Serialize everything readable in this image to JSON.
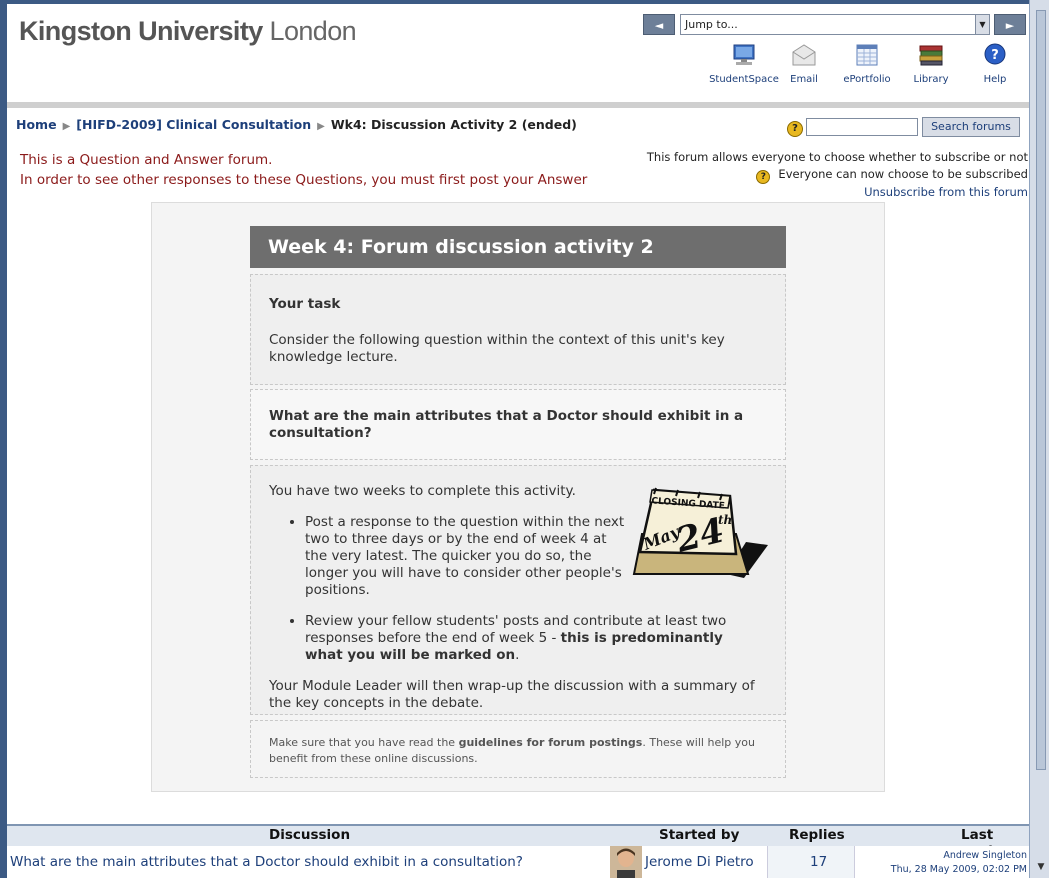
{
  "header": {
    "logo_bold": "Kingston University",
    "logo_light": "London",
    "jump_to": "Jump to...",
    "jump_prev": "◄",
    "jump_next": "►",
    "quick_links": {
      "studentspace": "StudentSpace",
      "email": "Email",
      "eportfolio": "ePortfolio",
      "library": "Library",
      "help": "Help"
    }
  },
  "breadcrumb": {
    "home": "Home",
    "course": "[HIFD-2009] Clinical Consultation",
    "current": "Wk4: Discussion Activity 2 (ended)"
  },
  "search": {
    "button": "Search forums",
    "value": ""
  },
  "notice": {
    "line1": "This is a Question and Answer forum.",
    "line2": "In order to see other responses to these Questions, you must  first post your Answer"
  },
  "subscription": {
    "line1": "This forum allows everyone to choose whether to subscribe or not",
    "line2": "Everyone can now choose to be subscribed",
    "unsubscribe": "Unsubscribe from this forum"
  },
  "intro": {
    "title": "Week 4: Forum discussion activity 2",
    "task_heading": "Your task",
    "task_text": "Consider the following question within the context of this unit's key knowledge lecture.",
    "question": "What are the main attributes that a Doctor should exhibit in a consultation?",
    "lead": "You have two weeks to complete this activity.",
    "bullet1": "Post a response to the question within the next two to three days or by the end of week 4 at the very latest. The quicker you do so, the longer you will have to consider other people's positions.",
    "bullet2_plain": "Review your fellow students' posts and contribute at least two responses before the end of week 5 - ",
    "bullet2_bold": "this is predominantly what you will be marked on",
    "bullet2_end": ".",
    "closing": "Your Module Leader will then wrap-up the discussion with a summary of the key concepts in the debate.",
    "guidelines_pre": "Make sure that you have read the ",
    "guidelines_bold": "guidelines for forum postings",
    "guidelines_post": ". These will help you benefit from these online discussions.",
    "calendar_heading": "CLOSING DATE",
    "calendar_month": "May",
    "calendar_day": "24",
    "calendar_suffix": "th"
  },
  "table": {
    "headers": {
      "discussion": "Discussion",
      "started_by": "Started by",
      "replies": "Replies",
      "last_post": "Last post"
    },
    "rows": [
      {
        "subject": "What are the main attributes that a Doctor should exhibit in a consultation?",
        "author": "Jerome Di Pietro",
        "replies": "17",
        "last_author": "Andrew Singleton",
        "last_date": "Thu, 28 May 2009, 02:02 PM"
      }
    ]
  }
}
